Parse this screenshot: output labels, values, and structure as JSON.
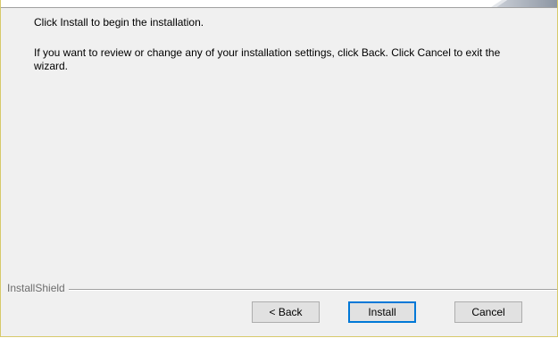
{
  "dialog": {
    "intro_text": "Click Install to begin the installation.",
    "review_text": "If you want to review or change any of your installation settings, click Back. Click Cancel to exit the wizard.",
    "branding_label": "InstallShield"
  },
  "buttons": {
    "back_label": "< Back",
    "install_label": "Install",
    "cancel_label": "Cancel"
  },
  "colors": {
    "dialog_background": "#f0f0f0",
    "default_button_border": "#0078d7",
    "frame_border": "#d7c96a"
  }
}
